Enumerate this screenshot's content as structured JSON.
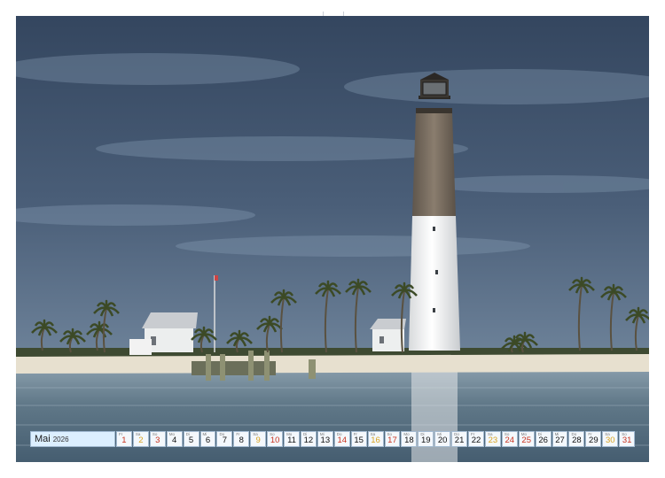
{
  "calendar": {
    "month": "Mai",
    "year": "2026",
    "days": [
      {
        "day": "1",
        "weekday": "Fr",
        "type": "holiday"
      },
      {
        "day": "2",
        "weekday": "Sa",
        "type": "saturday"
      },
      {
        "day": "3",
        "weekday": "So",
        "type": "sunday"
      },
      {
        "day": "4",
        "weekday": "Mo",
        "type": "weekday"
      },
      {
        "day": "5",
        "weekday": "Di",
        "type": "weekday"
      },
      {
        "day": "6",
        "weekday": "Mi",
        "type": "weekday"
      },
      {
        "day": "7",
        "weekday": "Do",
        "type": "weekday"
      },
      {
        "day": "8",
        "weekday": "Fr",
        "type": "weekday"
      },
      {
        "day": "9",
        "weekday": "Sa",
        "type": "saturday"
      },
      {
        "day": "10",
        "weekday": "So",
        "type": "sunday"
      },
      {
        "day": "11",
        "weekday": "Mo",
        "type": "weekday"
      },
      {
        "day": "12",
        "weekday": "Di",
        "type": "weekday"
      },
      {
        "day": "13",
        "weekday": "Mi",
        "type": "weekday"
      },
      {
        "day": "14",
        "weekday": "Do",
        "type": "holiday"
      },
      {
        "day": "15",
        "weekday": "Fr",
        "type": "weekday"
      },
      {
        "day": "16",
        "weekday": "Sa",
        "type": "saturday"
      },
      {
        "day": "17",
        "weekday": "So",
        "type": "sunday"
      },
      {
        "day": "18",
        "weekday": "Mo",
        "type": "weekday"
      },
      {
        "day": "19",
        "weekday": "Di",
        "type": "weekday"
      },
      {
        "day": "20",
        "weekday": "Mi",
        "type": "weekday"
      },
      {
        "day": "21",
        "weekday": "Do",
        "type": "weekday"
      },
      {
        "day": "22",
        "weekday": "Fr",
        "type": "weekday"
      },
      {
        "day": "23",
        "weekday": "Sa",
        "type": "saturday"
      },
      {
        "day": "24",
        "weekday": "So",
        "type": "sunday"
      },
      {
        "day": "25",
        "weekday": "Mo",
        "type": "holiday"
      },
      {
        "day": "26",
        "weekday": "Di",
        "type": "weekday"
      },
      {
        "day": "27",
        "weekday": "Mi",
        "type": "weekday"
      },
      {
        "day": "28",
        "weekday": "Do",
        "type": "weekday"
      },
      {
        "day": "29",
        "weekday": "Fr",
        "type": "weekday"
      },
      {
        "day": "30",
        "weekday": "Sa",
        "type": "saturday"
      },
      {
        "day": "31",
        "weekday": "So",
        "type": "sunday"
      }
    ]
  },
  "colors": {
    "sky": "#3f5169",
    "water": "#5b7284",
    "sand": "#e8e2d2",
    "tower_top": "#7b6f62",
    "tower_bottom": "#f2f2f0",
    "saturday": "#d8a322",
    "sunday": "#c8321f"
  }
}
